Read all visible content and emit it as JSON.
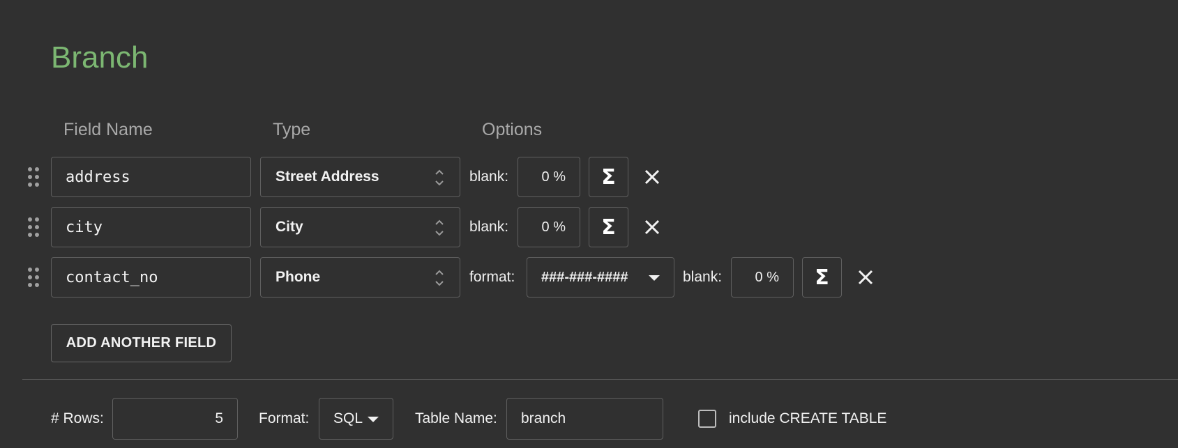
{
  "schema": {
    "title": "Branch",
    "headers": {
      "field_name": "Field Name",
      "type": "Type",
      "options": "Options"
    },
    "fields": [
      {
        "name": "address",
        "type": "Street Address",
        "blank_label": "blank:",
        "blank_value": "0 %"
      },
      {
        "name": "city",
        "type": "City",
        "blank_label": "blank:",
        "blank_value": "0 %"
      },
      {
        "name": "contact_no",
        "type": "Phone",
        "format_label": "format:",
        "format_value": "###-###-####",
        "blank_label": "blank:",
        "blank_value": "0 %"
      }
    ],
    "sigma_symbol": "Σ",
    "add_field_label": "ADD ANOTHER FIELD"
  },
  "footer": {
    "rows_label": "# Rows:",
    "rows_value": "5",
    "format_label": "Format:",
    "format_value": "SQL",
    "table_name_label": "Table Name:",
    "table_name_value": "branch",
    "create_table_label": "include CREATE TABLE",
    "create_table_checked": false
  },
  "colors": {
    "title": "#7cb772",
    "background": "#303030"
  },
  "icons": [
    "drag-handle-icon",
    "updown-arrows-icon",
    "sigma-icon",
    "close-icon",
    "caret-down-icon"
  ]
}
